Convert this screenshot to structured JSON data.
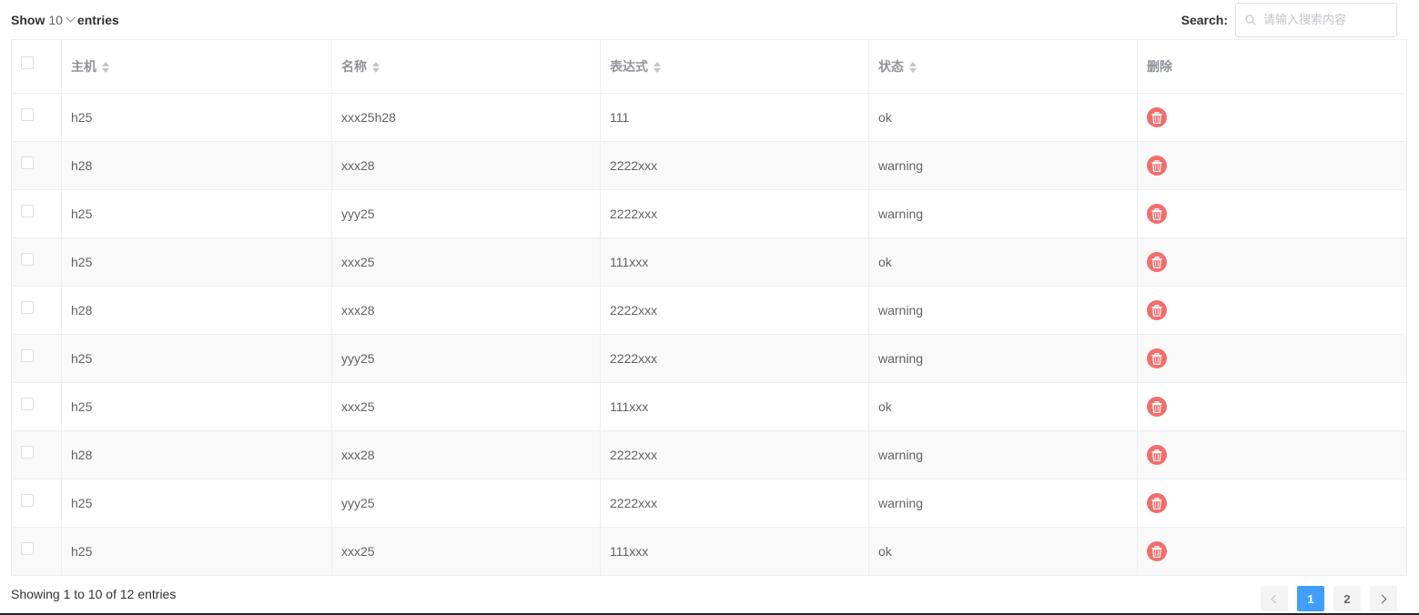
{
  "length_menu": {
    "prefix": "Show",
    "value": "10",
    "suffix": "entries"
  },
  "search": {
    "label": "Search:",
    "placeholder": "请输入搜索内容"
  },
  "table": {
    "headers": [
      "主机",
      "名称",
      "表达式",
      "状态",
      "删除"
    ],
    "rows": [
      {
        "host": "h25",
        "name": "xxx25h28",
        "expr": "111",
        "status": "ok"
      },
      {
        "host": "h28",
        "name": "xxx28",
        "expr": "2222xxx",
        "status": "warning"
      },
      {
        "host": "h25",
        "name": "yyy25",
        "expr": "2222xxx",
        "status": "warning"
      },
      {
        "host": "h25",
        "name": "xxx25",
        "expr": "111xxx",
        "status": "ok"
      },
      {
        "host": "h28",
        "name": "xxx28",
        "expr": "2222xxx",
        "status": "warning"
      },
      {
        "host": "h25",
        "name": "yyy25",
        "expr": "2222xxx",
        "status": "warning"
      },
      {
        "host": "h25",
        "name": "xxx25",
        "expr": "111xxx",
        "status": "ok"
      },
      {
        "host": "h28",
        "name": "xxx28",
        "expr": "2222xxx",
        "status": "warning"
      },
      {
        "host": "h25",
        "name": "yyy25",
        "expr": "2222xxx",
        "status": "warning"
      },
      {
        "host": "h25",
        "name": "xxx25",
        "expr": "111xxx",
        "status": "ok"
      }
    ]
  },
  "info": "Showing 1 to 10 of 12 entries",
  "pagination": {
    "pages": [
      "1",
      "2"
    ],
    "current": "1"
  },
  "icons": {
    "delete": "trash-icon",
    "search": "search-icon",
    "prev": "chevron-left-icon",
    "next": "chevron-right-icon",
    "dropdown": "chevron-down-icon",
    "sort": "sort-icon"
  },
  "colors": {
    "primary": "#409eff",
    "danger": "#f56c6c"
  }
}
